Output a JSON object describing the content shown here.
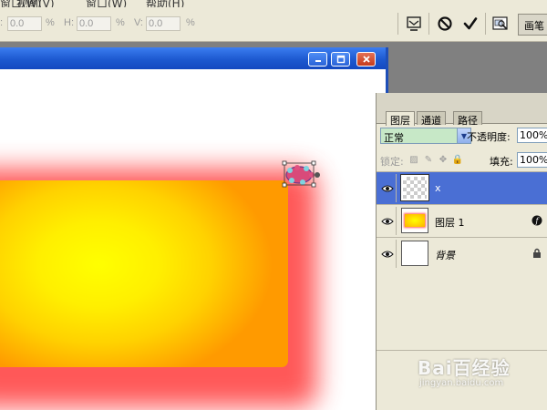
{
  "menubar": {
    "items": [
      "窗口(W)",
      "视图(V)",
      "窗口(W)",
      "帮助(H)"
    ]
  },
  "options_bar": {
    "x_unit": "%",
    "h_label": "H:",
    "h_value": "0.0",
    "h_unit": "%",
    "v_label": "V:",
    "v_value": "0.0",
    "v_unit": "%",
    "first_value": "0.0",
    "brushes_tab": "画笔",
    "icons": [
      "warp-mode-icon",
      "cancel-transform-icon",
      "commit-transform-icon",
      "file-browser-icon"
    ]
  },
  "document": {
    "title_buttons": [
      "minimize",
      "maximize",
      "close"
    ]
  },
  "layers_panel": {
    "tabs": [
      "图层",
      "通道",
      "路径"
    ],
    "active_tab": 0,
    "blend_mode": "正常",
    "opacity_label": "不透明度:",
    "opacity_value": "100%",
    "lock_label": "锁定:",
    "fill_label": "填充:",
    "fill_value": "100%",
    "layers": [
      {
        "name": "x",
        "selected": true,
        "visible": true,
        "thumb": "transparent"
      },
      {
        "name": "图层 1",
        "selected": false,
        "visible": true,
        "thumb": "gradient",
        "badge": "fx"
      },
      {
        "name": "背景",
        "selected": false,
        "visible": true,
        "thumb": "white",
        "badge": "lock",
        "italic": true
      }
    ]
  },
  "watermark": {
    "brand": "Bai百经验",
    "url": "jingyan.baidu.com"
  },
  "colors": {
    "selection": "#4a6fd4",
    "titlebar": "#1d59d0",
    "panel_bg": "#ece9d8",
    "glow": "#ff3b3b",
    "fill_center": "#ffff00",
    "fill_edge": "#ff9a00"
  }
}
